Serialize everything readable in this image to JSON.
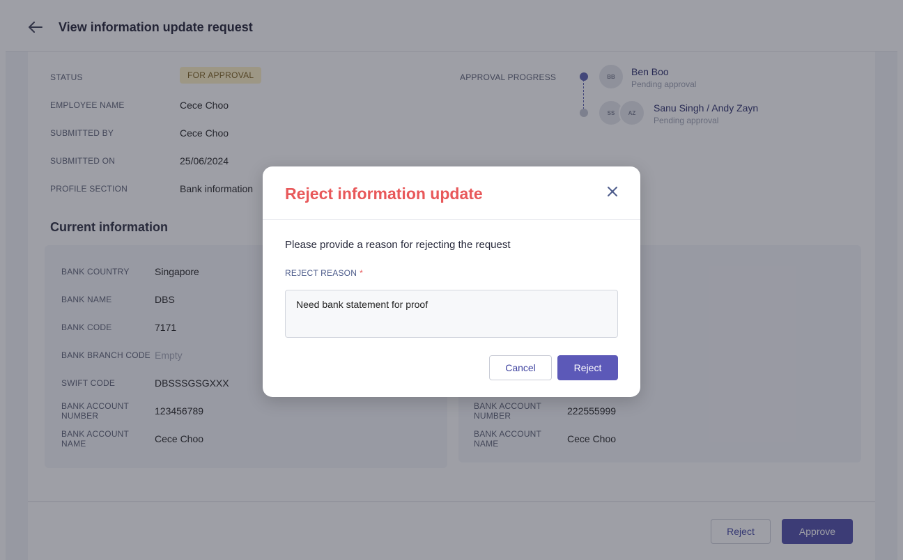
{
  "header": {
    "title": "View information update request"
  },
  "summary": {
    "status_label": "STATUS",
    "status_value": "FOR APPROVAL",
    "employee_label": "EMPLOYEE NAME",
    "employee_value": "Cece Choo",
    "submitted_by_label": "SUBMITTED BY",
    "submitted_by_value": "Cece Choo",
    "submitted_on_label": "SUBMITTED ON",
    "submitted_on_value": "25/06/2024",
    "section_label": "PROFILE SECTION",
    "section_value": "Bank information"
  },
  "approval": {
    "label": "APPROVAL PROGRESS",
    "steps": [
      {
        "initials": "BB",
        "name": "Ben Boo",
        "status": "Pending approval"
      },
      {
        "initials_a": "SS",
        "initials_b": "AZ",
        "name": "Sanu Singh / Andy Zayn",
        "status": "Pending approval"
      }
    ]
  },
  "current_info": {
    "title": "Current information",
    "fields": [
      {
        "label": "BANK COUNTRY",
        "value": "Singapore"
      },
      {
        "label": "BANK NAME",
        "value": "DBS"
      },
      {
        "label": "BANK CODE",
        "value": "7171"
      },
      {
        "label": "BANK BRANCH CODE",
        "value": "Empty"
      },
      {
        "label": "SWIFT CODE",
        "value": "DBSSSGSGXXX"
      },
      {
        "label": "BANK ACCOUNT NUMBER",
        "value": "123456789"
      },
      {
        "label": "BANK ACCOUNT NAME",
        "value": "Cece Choo"
      }
    ]
  },
  "updated_info": {
    "fields": [
      {
        "label": "BANK ACCOUNT NUMBER",
        "value": "222555999"
      },
      {
        "label": "BANK ACCOUNT NAME",
        "value": "Cece Choo"
      }
    ]
  },
  "footer": {
    "reject_label": "Reject",
    "approve_label": "Approve"
  },
  "modal": {
    "title": "Reject information update",
    "prompt": "Please provide a reason for rejecting the request",
    "reason_label": "REJECT REASON",
    "required_mark": "*",
    "reason_value": "Need bank statement for proof",
    "cancel_label": "Cancel",
    "reject_label": "Reject"
  },
  "colors": {
    "accent": "#5c59b8",
    "danger": "#e8585a",
    "status_badge_bg": "#fdf1c4"
  },
  "icons": {
    "back": "arrow-left-icon",
    "close": "close-icon"
  }
}
